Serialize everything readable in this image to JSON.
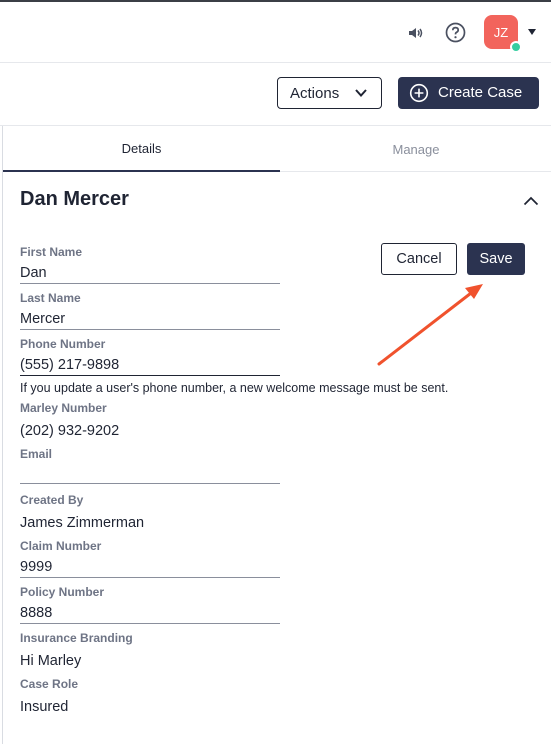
{
  "topbar": {
    "speaker_icon": "speaker-icon",
    "help_icon": "help-circle-icon",
    "avatar_initials": "JZ",
    "status_color": "#35cda0",
    "avatar_color": "#f2645c"
  },
  "actionbar": {
    "actions_label": "Actions",
    "create_case_label": "Create Case"
  },
  "tabs": {
    "details": "Details",
    "manage": "Manage"
  },
  "profile": {
    "name": "Dan Mercer",
    "cancel_label": "Cancel",
    "save_label": "Save",
    "fields": {
      "first_name_label": "First Name",
      "first_name_value": "Dan",
      "last_name_label": "Last Name",
      "last_name_value": "Mercer",
      "phone_label": "Phone Number",
      "phone_value": "(555) 217-9898",
      "phone_hint": "If you update a user's phone number, a new welcome message must be sent.",
      "marley_label": "Marley Number",
      "marley_value": "(202) 932-9202",
      "email_label": "Email",
      "email_value": "",
      "created_by_label": "Created By",
      "created_by_value": "James Zimmerman",
      "claim_label": "Claim Number",
      "claim_value": "9999",
      "policy_label": "Policy Number",
      "policy_value": "8888",
      "branding_label": "Insurance Branding",
      "branding_value": "Hi Marley",
      "case_role_label": "Case Role",
      "case_role_value": "Insured"
    }
  },
  "colors": {
    "primary": "#2b3350",
    "annotation_arrow": "#f0522d"
  }
}
